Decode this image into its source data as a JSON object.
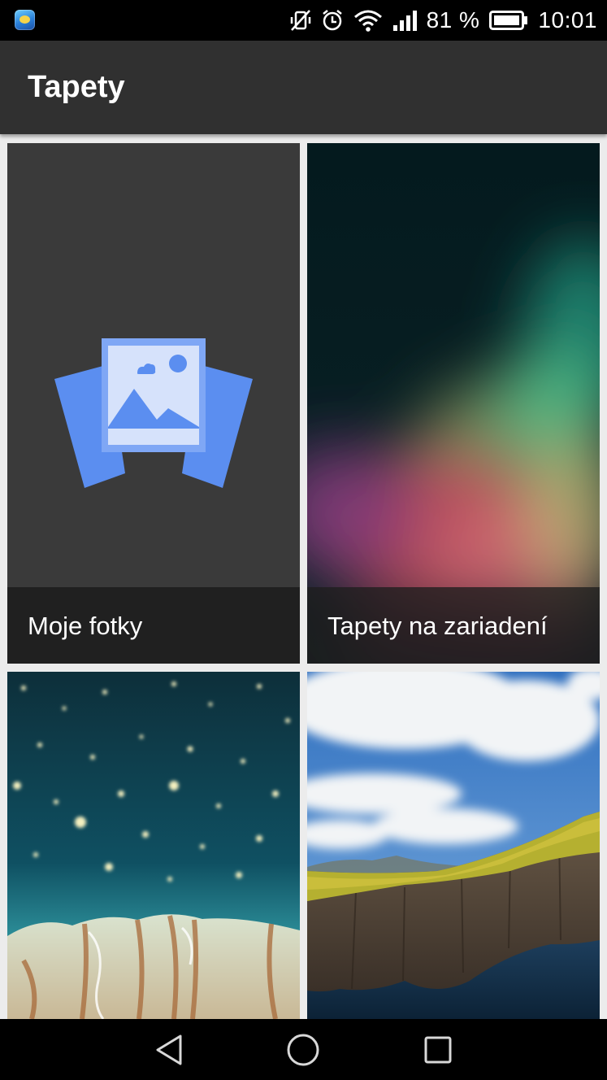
{
  "status_bar": {
    "battery_percent": "81 %",
    "time": "10:01",
    "icons": [
      "app-notification-icon",
      "vibrate-off-icon",
      "alarm-icon",
      "wifi-icon",
      "signal-icon",
      "battery-icon"
    ]
  },
  "app_bar": {
    "title": "Tapety"
  },
  "tiles": [
    {
      "label": "Moje fotky",
      "icon": "photo-gallery-icon"
    },
    {
      "label": "Tapety na zariadení"
    },
    {
      "label": ""
    },
    {
      "label": ""
    }
  ],
  "nav_bar": {
    "icons": [
      "back-icon",
      "home-icon",
      "recent-apps-icon"
    ]
  },
  "colors": {
    "status_bar": "#000000",
    "app_bar": "#303030",
    "background": "#ececec",
    "accent_blue": "#5b8ef0"
  }
}
